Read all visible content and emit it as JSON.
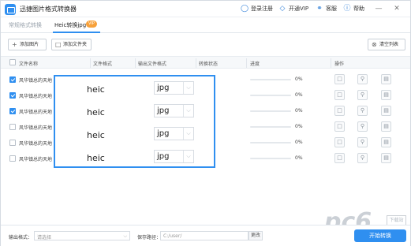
{
  "app": {
    "title": "迅捷图片格式转换器",
    "nav": {
      "login": "登录注册",
      "vip": "开通VIP",
      "service": "客服",
      "help": "帮助"
    }
  },
  "tabs": {
    "normal": "常规格式转换",
    "active": "Heic转换jpg",
    "badge": "VIP"
  },
  "toolbar": {
    "add_image": "添加图片",
    "add_folder": "添加文件夹",
    "clear_list": "清空列表"
  },
  "table": {
    "headers": [
      "文件名称",
      "文件格式",
      "输出文件格式",
      "转换状态",
      "进度",
      "操作"
    ],
    "rows": [
      {
        "name": "风华镇总的天地",
        "checked": true,
        "progress_label": "0%",
        "progress": 0
      },
      {
        "name": "风华镇总的天地",
        "checked": true,
        "progress_label": "0%",
        "progress": 0
      },
      {
        "name": "风华镇总的天地",
        "checked": true,
        "progress_label": "0%",
        "progress": 0
      },
      {
        "name": "风华镇总的天地",
        "checked": false,
        "progress_label": "0%",
        "progress": 0
      },
      {
        "name": "风华镇总的天地",
        "checked": false,
        "progress_label": "0%",
        "progress": 0
      },
      {
        "name": "风华镇总的天地",
        "checked": false,
        "progress_label": "0%",
        "progress": 0
      }
    ]
  },
  "overlay": {
    "rows": [
      {
        "from": "heic",
        "to": "jpg"
      },
      {
        "from": "heic",
        "to": "jpg"
      },
      {
        "from": "heic",
        "to": "jpg"
      },
      {
        "from": "heic",
        "to": "jpg"
      }
    ]
  },
  "footer": {
    "output_format_label": "输出格式：",
    "output_format_placeholder": "请选择",
    "save_path_label": "保存路径：",
    "save_path_value": "C:/user/",
    "change_label": "更改",
    "start_button": "开始转换"
  },
  "watermark": {
    "text": "pc6",
    "badge": "下载站"
  },
  "colors": {
    "accent": "#2f8ff0",
    "vip_badge": "#f7a13a"
  }
}
